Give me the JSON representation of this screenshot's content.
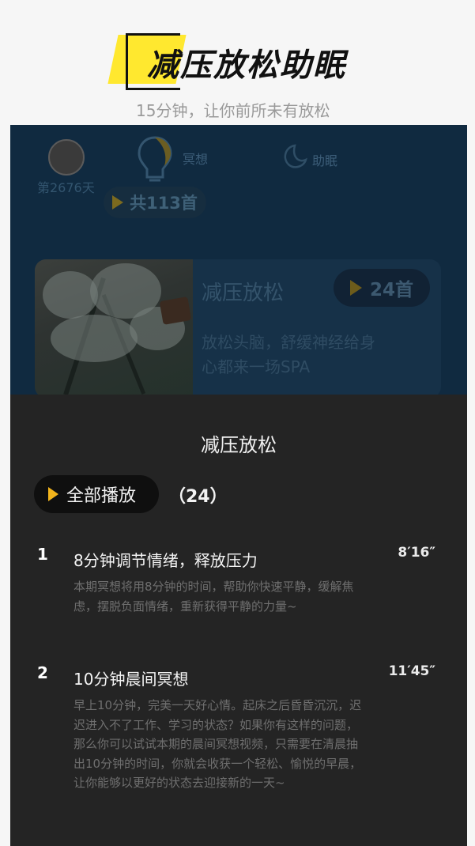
{
  "hero": {
    "title": "减压放松助眠",
    "subtitle": "15分钟，让你前所未有放松"
  },
  "topbar": {
    "day_count": "第2676天",
    "tab_meditation": "冥想",
    "tab_sleep": "助眠",
    "total_label": "共113首"
  },
  "card": {
    "title": "减压放松",
    "description": "放松头脑，舒缓神经给身心都来一场SPA",
    "count_label": "24首"
  },
  "sheet": {
    "title": "减压放松",
    "play_all_label": "全部播放",
    "play_count": "（24）",
    "items": [
      {
        "number": "1",
        "title": "8分钟调节情绪，释放压力",
        "duration": "8′16″",
        "description": "本期冥想将用8分钟的时间，帮助你快速平静，缓解焦虑，摆脱负面情绪，重新获得平静的力量~"
      },
      {
        "number": "2",
        "title": "10分钟晨间冥想",
        "duration": "11′45″",
        "description": "早上10分钟，完美一天好心情。起床之后昏昏沉沉，迟迟进入不了工作、学习的状态？如果你有这样的问题，那么你可以试试本期的晨间冥想视频，只需要在清晨抽出10分钟的时间，你就会收获一个轻松、愉悦的早晨，让你能够以更好的状态去迎接新的一天~"
      }
    ]
  },
  "colors": {
    "accent": "#f2b41c",
    "hero_highlight": "#ffe82f",
    "sheet_bg": "#242424",
    "screen_bg": "#102a40"
  }
}
